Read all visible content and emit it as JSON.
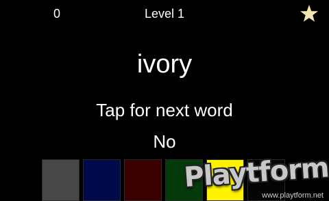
{
  "hud": {
    "score": "0",
    "level": "Level 1",
    "favorite_icon": "star-icon",
    "star_color": "#f2e6b0"
  },
  "game": {
    "word": "ivory",
    "prompt": "Tap for next word",
    "answer": "No"
  },
  "palette": [
    {
      "name": "gray",
      "color": "#474747"
    },
    {
      "name": "navy",
      "color": "#000a4a"
    },
    {
      "name": "maroon",
      "color": "#3a0000"
    },
    {
      "name": "dark-green",
      "color": "#053a0a"
    },
    {
      "name": "yellow",
      "color": "#fff200"
    },
    {
      "name": "black",
      "color": "#050505"
    }
  ],
  "watermark": {
    "logo": "Playtform",
    "url": "www.playtform.net"
  }
}
